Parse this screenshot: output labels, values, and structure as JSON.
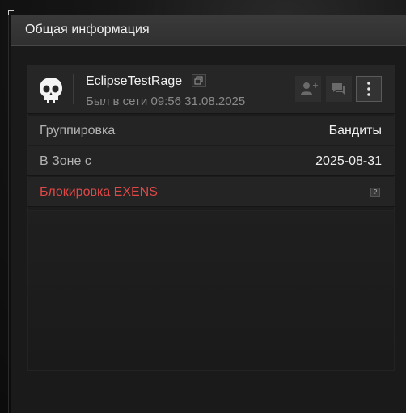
{
  "panel": {
    "title": "Общая информация"
  },
  "profile": {
    "username": "EclipseTestRage",
    "last_seen": "Был в сети 09:56 31.08.2025"
  },
  "info_rows": [
    {
      "label": "Группировка",
      "value": "Бандиты"
    },
    {
      "label": "В Зоне с",
      "value": "2025-08-31"
    },
    {
      "label": "Блокировка EXENS",
      "help": "?"
    }
  ],
  "colors": {
    "accent_danger": "#e04848",
    "header_bg": "#353535",
    "row_bg": "#242424"
  },
  "icons": {
    "avatar": "skull-icon",
    "copy": "copy-icon",
    "add_friend": "add-friend-icon",
    "message": "message-icon",
    "more": "more-vertical-icon",
    "help": "help-icon"
  }
}
